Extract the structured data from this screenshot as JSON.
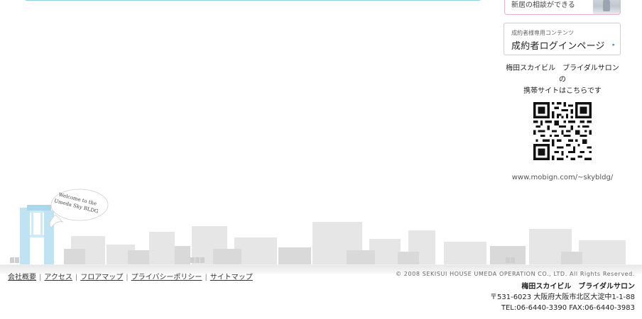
{
  "sidebar": {
    "promo_text": "新居の相談ができる",
    "login_subtitle": "成約者様専用コンテンツ",
    "login_title": "成約者ログインページ",
    "login_arrow": "▸",
    "mobile_line1": "梅田スカイビル　ブライダルサロン",
    "mobile_line2": "の",
    "mobile_line3": "携帯サイトはこちらです",
    "mobile_url": "www.mobign.com/~skybldg/"
  },
  "illustration": {
    "bubble_line1": "Welcome to the",
    "bubble_line2": "Umeda Sky BLDG"
  },
  "footer": {
    "links": [
      "会社概要",
      "アクセス",
      "フロアマップ",
      "プライバシーポリシー",
      "サイトマップ"
    ],
    "separator": "|",
    "copyright": "© 2008 SEKISUI HOUSE UMEDA OPERATION CO., LTD. All Rights Reserved.",
    "company_name": "梅田スカイビル　ブライダルサロン",
    "address": "〒531-6023 大阪府大阪市北区大淀中1-1-88",
    "phone": "TEL:06-6440-3390 FAX:06-6440-3983"
  },
  "colors": {
    "panel_border": "#8fd3e4",
    "building_blue": "#bfe3f2",
    "skyline_gray": "#dcdcdc",
    "link_arrow": "#2b86c5"
  }
}
